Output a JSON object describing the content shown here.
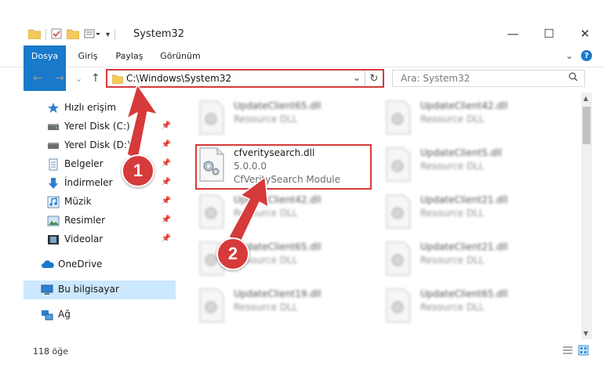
{
  "window": {
    "title": "System32",
    "minimize": "—",
    "maximize": "☐",
    "close": "✕"
  },
  "ribbon": {
    "tabs": [
      "Dosya",
      "Giriş",
      "Paylaş",
      "Görünüm"
    ],
    "expand": "⌄",
    "help": "?"
  },
  "nav": {
    "back": "←",
    "forward": "→",
    "recent": "⌄",
    "up": "↑"
  },
  "address": {
    "path": "C:\\Windows\\System32",
    "dropdown": "⌄",
    "refresh": "↻"
  },
  "search": {
    "placeholder": "Ara: System32",
    "icon": "search-icon"
  },
  "sidebar": {
    "items": [
      {
        "label": "Hızlı erişim",
        "icon": "star-icon"
      },
      {
        "label": "Yerel Disk (C:)",
        "icon": "drive-icon",
        "pinned": true
      },
      {
        "label": "Yerel Disk (D:)",
        "icon": "drive-icon",
        "pinned": true
      },
      {
        "label": "Belgeler",
        "icon": "documents-icon",
        "pinned": true
      },
      {
        "label": "İndirmeler",
        "icon": "download-icon",
        "pinned": true
      },
      {
        "label": "Müzik",
        "icon": "music-icon",
        "pinned": true
      },
      {
        "label": "Resimler",
        "icon": "pictures-icon",
        "pinned": true
      },
      {
        "label": "Videolar",
        "icon": "video-icon",
        "pinned": true
      },
      {
        "label": "OneDrive",
        "icon": "cloud-icon"
      },
      {
        "label": "Bu bilgisayar",
        "icon": "computer-icon",
        "selected": true
      },
      {
        "label": "Ağ",
        "icon": "network-icon"
      }
    ],
    "pin_glyph": "📌"
  },
  "files": {
    "featured": {
      "name": "cfveritysearch.dll",
      "version": "5.0.0.0",
      "description": "CfVeritySearch Module"
    },
    "blurred": [
      {
        "name": "UpdateClient65.dll",
        "type": "Resource DLL"
      },
      {
        "name": "UpdateClient42.dll",
        "type": "Resource DLL"
      },
      {
        "name": "UpdateClient5.dll",
        "type": "Resource DLL"
      },
      {
        "name": "UpdateClient42.dll",
        "type": "Resource DLL"
      },
      {
        "name": "UpdateClient21.dll",
        "type": "Resource DLL"
      },
      {
        "name": "UpdateClient65.dll",
        "type": "Resource DLL"
      },
      {
        "name": "UpdateClient21.dll",
        "type": "Resource DLL"
      },
      {
        "name": "UpdateClient19.dll",
        "type": "Resource DLL"
      },
      {
        "name": "UpdateClient65.dll",
        "type": "Resource DLL"
      }
    ]
  },
  "status": {
    "count": "118 öğe"
  },
  "annotations": {
    "badge1": "1",
    "badge2": "2",
    "color": "#d63a3a"
  }
}
